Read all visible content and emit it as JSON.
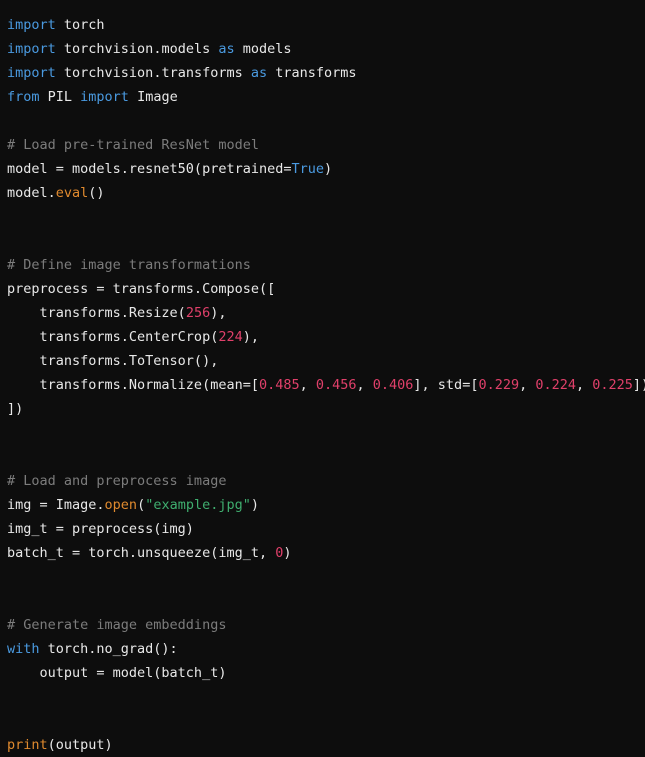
{
  "editor": {
    "language": "python",
    "background_color": "#0d0d0d",
    "theme_colors": {
      "keyword": "#4a9ae0",
      "comment": "#7c7c7c",
      "number": "#e0406a",
      "string": "#3fae6f",
      "builtin_function": "#e08a2e",
      "plain_text": "#e8e8e8"
    },
    "lines": [
      {
        "id": "l1",
        "tokens": [
          {
            "t": "import",
            "c": "kw"
          },
          {
            "t": " torch",
            "c": "plain"
          }
        ]
      },
      {
        "id": "l2",
        "tokens": [
          {
            "t": "import",
            "c": "kw"
          },
          {
            "t": " torchvision.models ",
            "c": "plain"
          },
          {
            "t": "as",
            "c": "kw"
          },
          {
            "t": " models",
            "c": "plain"
          }
        ]
      },
      {
        "id": "l3",
        "tokens": [
          {
            "t": "import",
            "c": "kw"
          },
          {
            "t": " torchvision.transforms ",
            "c": "plain"
          },
          {
            "t": "as",
            "c": "kw"
          },
          {
            "t": " transforms",
            "c": "plain"
          }
        ]
      },
      {
        "id": "l4",
        "tokens": [
          {
            "t": "from",
            "c": "kw"
          },
          {
            "t": " PIL ",
            "c": "plain"
          },
          {
            "t": "import",
            "c": "kw"
          },
          {
            "t": " Image",
            "c": "plain"
          }
        ]
      },
      {
        "id": "l5",
        "tokens": []
      },
      {
        "id": "l6",
        "tokens": [
          {
            "t": "# Load pre-trained ResNet model",
            "c": "comment"
          }
        ]
      },
      {
        "id": "l7",
        "tokens": [
          {
            "t": "model = models.resnet50(pretrained=",
            "c": "plain"
          },
          {
            "t": "True",
            "c": "kw"
          },
          {
            "t": ")",
            "c": "plain"
          }
        ]
      },
      {
        "id": "l8",
        "tokens": [
          {
            "t": "model.",
            "c": "plain"
          },
          {
            "t": "eval",
            "c": "fn"
          },
          {
            "t": "()",
            "c": "plain"
          }
        ]
      },
      {
        "id": "l9",
        "tokens": []
      },
      {
        "id": "l10",
        "tokens": []
      },
      {
        "id": "l11",
        "tokens": [
          {
            "t": "# Define image transformations",
            "c": "comment"
          }
        ]
      },
      {
        "id": "l12",
        "tokens": [
          {
            "t": "preprocess = transforms.Compose([",
            "c": "plain"
          }
        ]
      },
      {
        "id": "l13",
        "tokens": [
          {
            "t": "    transforms.Resize(",
            "c": "plain"
          },
          {
            "t": "256",
            "c": "num"
          },
          {
            "t": "),",
            "c": "plain"
          }
        ]
      },
      {
        "id": "l14",
        "tokens": [
          {
            "t": "    transforms.CenterCrop(",
            "c": "plain"
          },
          {
            "t": "224",
            "c": "num"
          },
          {
            "t": "),",
            "c": "plain"
          }
        ]
      },
      {
        "id": "l15",
        "tokens": [
          {
            "t": "    transforms.ToTensor(),",
            "c": "plain"
          }
        ]
      },
      {
        "id": "l16",
        "tokens": [
          {
            "t": "    transforms.Normalize(mean=[",
            "c": "plain"
          },
          {
            "t": "0.485",
            "c": "num"
          },
          {
            "t": ", ",
            "c": "plain"
          },
          {
            "t": "0.456",
            "c": "num"
          },
          {
            "t": ", ",
            "c": "plain"
          },
          {
            "t": "0.406",
            "c": "num"
          },
          {
            "t": "], std=[",
            "c": "plain"
          },
          {
            "t": "0.229",
            "c": "num"
          },
          {
            "t": ", ",
            "c": "plain"
          },
          {
            "t": "0.224",
            "c": "num"
          },
          {
            "t": ", ",
            "c": "plain"
          },
          {
            "t": "0.225",
            "c": "num"
          },
          {
            "t": "]),",
            "c": "plain"
          }
        ]
      },
      {
        "id": "l17",
        "tokens": [
          {
            "t": "])",
            "c": "plain"
          }
        ]
      },
      {
        "id": "l18",
        "tokens": []
      },
      {
        "id": "l19",
        "tokens": []
      },
      {
        "id": "l20",
        "tokens": [
          {
            "t": "# Load and preprocess image",
            "c": "comment"
          }
        ]
      },
      {
        "id": "l21",
        "tokens": [
          {
            "t": "img = Image.",
            "c": "plain"
          },
          {
            "t": "open",
            "c": "fn"
          },
          {
            "t": "(",
            "c": "plain"
          },
          {
            "t": "\"example.jpg\"",
            "c": "str"
          },
          {
            "t": ")",
            "c": "plain"
          }
        ]
      },
      {
        "id": "l22",
        "tokens": [
          {
            "t": "img_t = preprocess(img)",
            "c": "plain"
          }
        ]
      },
      {
        "id": "l23",
        "tokens": [
          {
            "t": "batch_t = torch.unsqueeze(img_t, ",
            "c": "plain"
          },
          {
            "t": "0",
            "c": "num"
          },
          {
            "t": ")",
            "c": "plain"
          }
        ]
      },
      {
        "id": "l24",
        "tokens": []
      },
      {
        "id": "l25",
        "tokens": []
      },
      {
        "id": "l26",
        "tokens": [
          {
            "t": "# Generate image embeddings",
            "c": "comment"
          }
        ]
      },
      {
        "id": "l27",
        "tokens": [
          {
            "t": "with",
            "c": "kw"
          },
          {
            "t": " torch.no_grad():",
            "c": "plain"
          }
        ]
      },
      {
        "id": "l28",
        "tokens": [
          {
            "t": "    output = model(batch_t)",
            "c": "plain"
          }
        ]
      },
      {
        "id": "l29",
        "tokens": []
      },
      {
        "id": "l30",
        "tokens": []
      },
      {
        "id": "l31",
        "tokens": [
          {
            "t": "print",
            "c": "fn"
          },
          {
            "t": "(output)",
            "c": "plain"
          }
        ]
      }
    ]
  }
}
